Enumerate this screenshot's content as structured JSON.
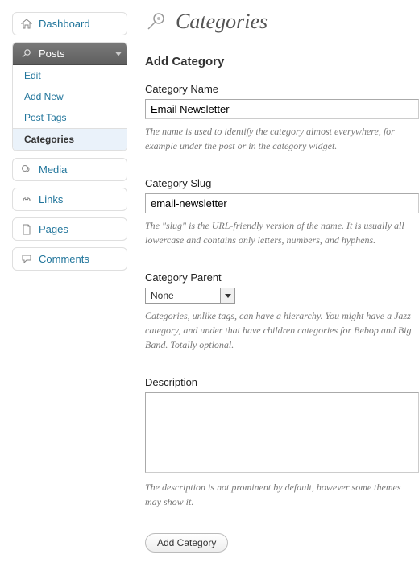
{
  "sidebar": {
    "dashboard": "Dashboard",
    "posts": "Posts",
    "posts_sub": {
      "edit": "Edit",
      "add_new": "Add New",
      "post_tags": "Post Tags",
      "categories": "Categories"
    },
    "media": "Media",
    "links": "Links",
    "pages": "Pages",
    "comments": "Comments"
  },
  "page": {
    "title": "Categories",
    "section_title": "Add Category"
  },
  "fields": {
    "name": {
      "label": "Category Name",
      "value": "Email Newsletter",
      "help": "The name is used to identify the category almost everywhere, for example under the post or in the category widget."
    },
    "slug": {
      "label": "Category Slug",
      "value": "email-newsletter",
      "help": "The \"slug\" is the URL-friendly version of the name. It is usually all lowercase and contains only letters, numbers, and hyphens."
    },
    "parent": {
      "label": "Category Parent",
      "selected": "None",
      "help": "Categories, unlike tags, can have a hierarchy. You might have a Jazz category, and under that have children categories for Bebop and Big Band. Totally optional."
    },
    "description": {
      "label": "Description",
      "value": "",
      "help": "The description is not prominent by default, however some themes may show it."
    }
  },
  "submit_label": "Add Category"
}
